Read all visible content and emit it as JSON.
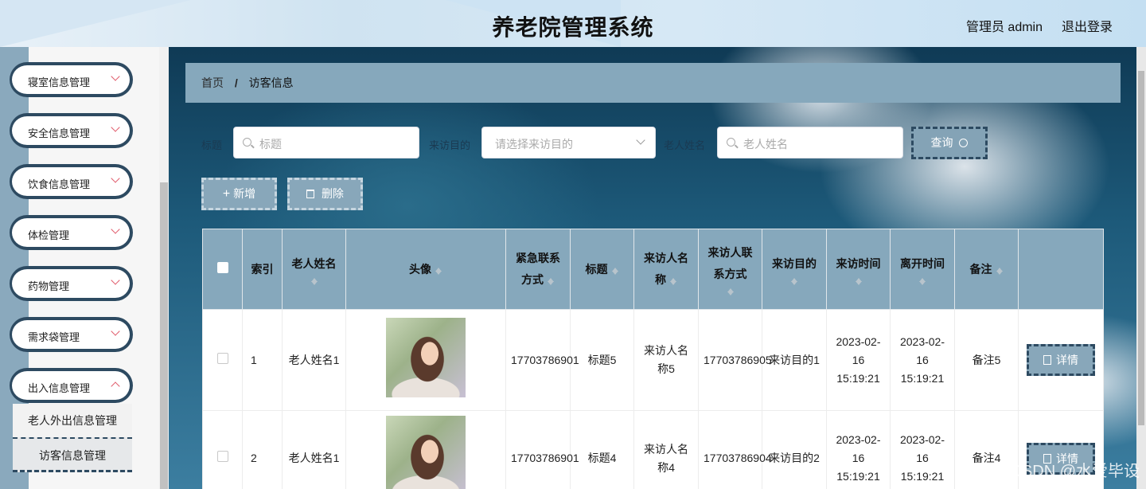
{
  "header": {
    "title": "养老院管理系统",
    "user": "管理员 admin",
    "logout": "退出登录"
  },
  "sidebar": {
    "items": [
      {
        "label": "寝室信息管理"
      },
      {
        "label": "安全信息管理"
      },
      {
        "label": "饮食信息管理"
      },
      {
        "label": "体检管理"
      },
      {
        "label": "药物管理"
      },
      {
        "label": "需求袋管理"
      },
      {
        "label": "出入信息管理"
      }
    ],
    "subitems": [
      {
        "label": "老人外出信息管理"
      },
      {
        "label": "访客信息管理"
      }
    ]
  },
  "breadcrumb": {
    "home": "首页",
    "sep": "/",
    "current": "访客信息"
  },
  "search": {
    "title_label": "标题",
    "title_placeholder": "标题",
    "purpose_label": "来访目的",
    "purpose_placeholder": "请选择来访目的",
    "elder_label": "老人姓名",
    "elder_placeholder": "老人姓名",
    "query_label": "查询"
  },
  "actions": {
    "add": "新增",
    "delete": "删除"
  },
  "table": {
    "headers": [
      "索引",
      "老人姓名",
      "头像",
      "紧急联系方式",
      "标题",
      "来访人名称",
      "来访人联系方式",
      "来访目的",
      "来访时间",
      "离开时间",
      "备注"
    ],
    "detail_label": "详情",
    "rows": [
      {
        "index": "1",
        "elder": "老人姓名1",
        "phone": "17703786901",
        "title": "标题5",
        "visitor": "来访人名称5",
        "visitor_phone": "17703786905",
        "purpose": "来访目的1",
        "visit_time": "2023-02-16 15:19:21",
        "leave_time": "2023-02-16 15:19:21",
        "note": "备注5"
      },
      {
        "index": "2",
        "elder": "老人姓名1",
        "phone": "17703786901",
        "title": "标题4",
        "visitor": "来访人名称4",
        "visitor_phone": "17703786904",
        "purpose": "来访目的2",
        "visit_time": "2023-02-16 15:19:21",
        "leave_time": "2023-02-16 15:19:21",
        "note": "备注4"
      }
    ]
  },
  "watermark": "CSDN @水爱毕设",
  "colors": {
    "accent": "#86a8bc",
    "border_dark": "#2d4a61",
    "sidebar_stripe": "#8aa9bd"
  }
}
